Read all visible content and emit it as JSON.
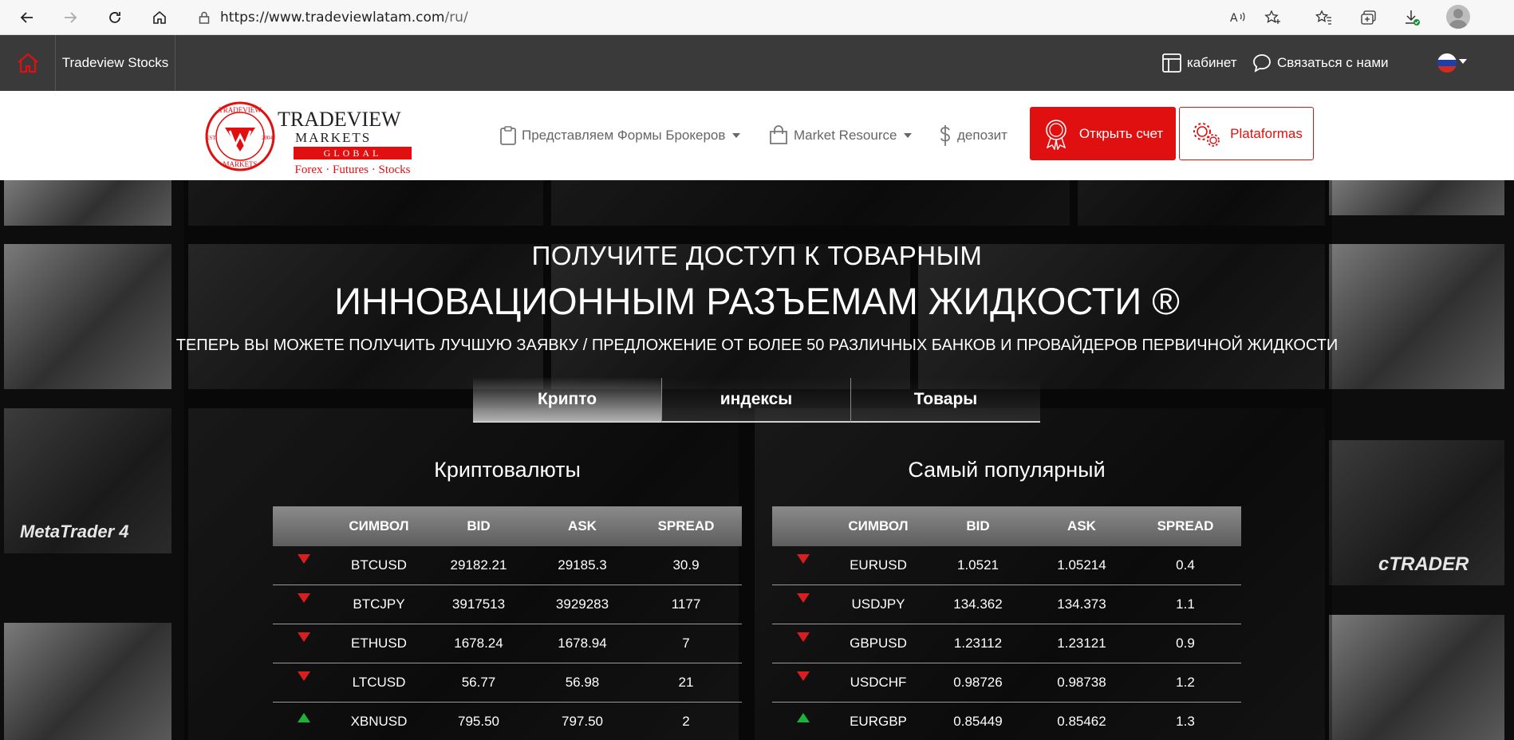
{
  "browser": {
    "url_domain": "https://www.tradeviewlatam.com",
    "url_path": "/ru/"
  },
  "topbar": {
    "stocks_label": "Tradeview Stocks",
    "cabinet_label": "кабинет",
    "contact_label": "Связаться с нами"
  },
  "logo": {
    "seal_top": "TRADEVIEW",
    "seal_bottom": "MARKETS",
    "seal_est": "EST.",
    "seal_year": "2004",
    "brand_name": "TRADEVIEW",
    "markets": "MARKETS",
    "global": "GLOBAL",
    "tagline": "Forex · Futures · Stocks"
  },
  "nav": {
    "brokers_label": "Представляем Формы Брокеров",
    "market_label": "Market Resource",
    "deposit_label": "депозит",
    "open_account_label": "Открыть счет",
    "platforms_label": "Plataformas"
  },
  "hero": {
    "line1": "ПОЛУЧИТЕ ДОСТУП К ТОВАРНЫМ",
    "line2": "ИННОВАЦИОННЫМ РАЗЪЕМАМ ЖИДКОСТИ ®",
    "line3": "ТЕПЕРЬ ВЫ МОЖЕТЕ ПОЛУЧИТЬ ЛУЧШУЮ ЗАЯВКУ / ПРЕДЛОЖЕНИЕ ОТ БОЛЕЕ 50 РАЗЛИЧНЫХ БАНКОВ И ПРОВАЙДЕРОВ ПЕРВИЧНОЙ ЖИДКОСТИ",
    "tabs": [
      "Крипто",
      "индексы",
      "Товары"
    ],
    "tile_metatrader": "MetaTrader 4",
    "tile_ctrader": "cTRADER"
  },
  "crypto_table": {
    "title": "Криптовалюты",
    "headers": [
      "СИМВОЛ",
      "BID",
      "ASK",
      "SPREAD"
    ],
    "rows": [
      {
        "dir": "down",
        "symbol": "BTCUSD",
        "bid": "29182.21",
        "ask": "29185.3",
        "spread": "30.9"
      },
      {
        "dir": "down",
        "symbol": "BTCJPY",
        "bid": "3917513",
        "ask": "3929283",
        "spread": "1177"
      },
      {
        "dir": "down",
        "symbol": "ETHUSD",
        "bid": "1678.24",
        "ask": "1678.94",
        "spread": "7"
      },
      {
        "dir": "down",
        "symbol": "LTCUSD",
        "bid": "56.77",
        "ask": "56.98",
        "spread": "21"
      },
      {
        "dir": "up",
        "symbol": "XBNUSD",
        "bid": "795.50",
        "ask": "797.50",
        "spread": "2"
      }
    ]
  },
  "popular_table": {
    "title": "Самый популярный",
    "headers": [
      "СИМВОЛ",
      "BID",
      "ASK",
      "SPREAD"
    ],
    "rows": [
      {
        "dir": "down",
        "symbol": "EURUSD",
        "bid": "1.0521",
        "ask": "1.05214",
        "spread": "0.4"
      },
      {
        "dir": "down",
        "symbol": "USDJPY",
        "bid": "134.362",
        "ask": "134.373",
        "spread": "1.1"
      },
      {
        "dir": "down",
        "symbol": "GBPUSD",
        "bid": "1.23112",
        "ask": "1.23121",
        "spread": "0.9"
      },
      {
        "dir": "down",
        "symbol": "USDCHF",
        "bid": "0.98726",
        "ask": "0.98738",
        "spread": "1.2"
      },
      {
        "dir": "up",
        "symbol": "EURGBP",
        "bid": "0.85449",
        "ask": "0.85462",
        "spread": "1.3"
      }
    ]
  },
  "colors": {
    "brand_red": "#e01010",
    "up_green": "#1db33a",
    "down_red": "#d81e1e",
    "topbar": "#3a3a3a"
  }
}
